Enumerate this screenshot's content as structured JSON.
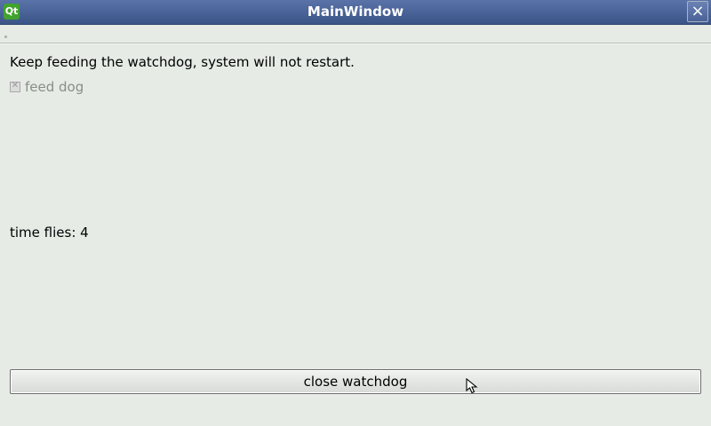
{
  "window": {
    "title": "MainWindow",
    "app_icon_label": "Qt",
    "close_glyph": "×"
  },
  "main": {
    "message": "Keep feeding the watchdog, system will not restart.",
    "checkbox": {
      "label": "feed dog",
      "checked": true,
      "enabled": false,
      "mark": "✕"
    },
    "counter_text": "time flies: 4",
    "close_button_label": "close watchdog"
  },
  "colors": {
    "titlebar": "#3b5488",
    "window_bg": "#e6ebe6",
    "app_icon": "#41a32d"
  },
  "icons": {
    "app": "qt-logo-icon",
    "close": "close-icon",
    "cursor": "mouse-pointer-icon"
  }
}
